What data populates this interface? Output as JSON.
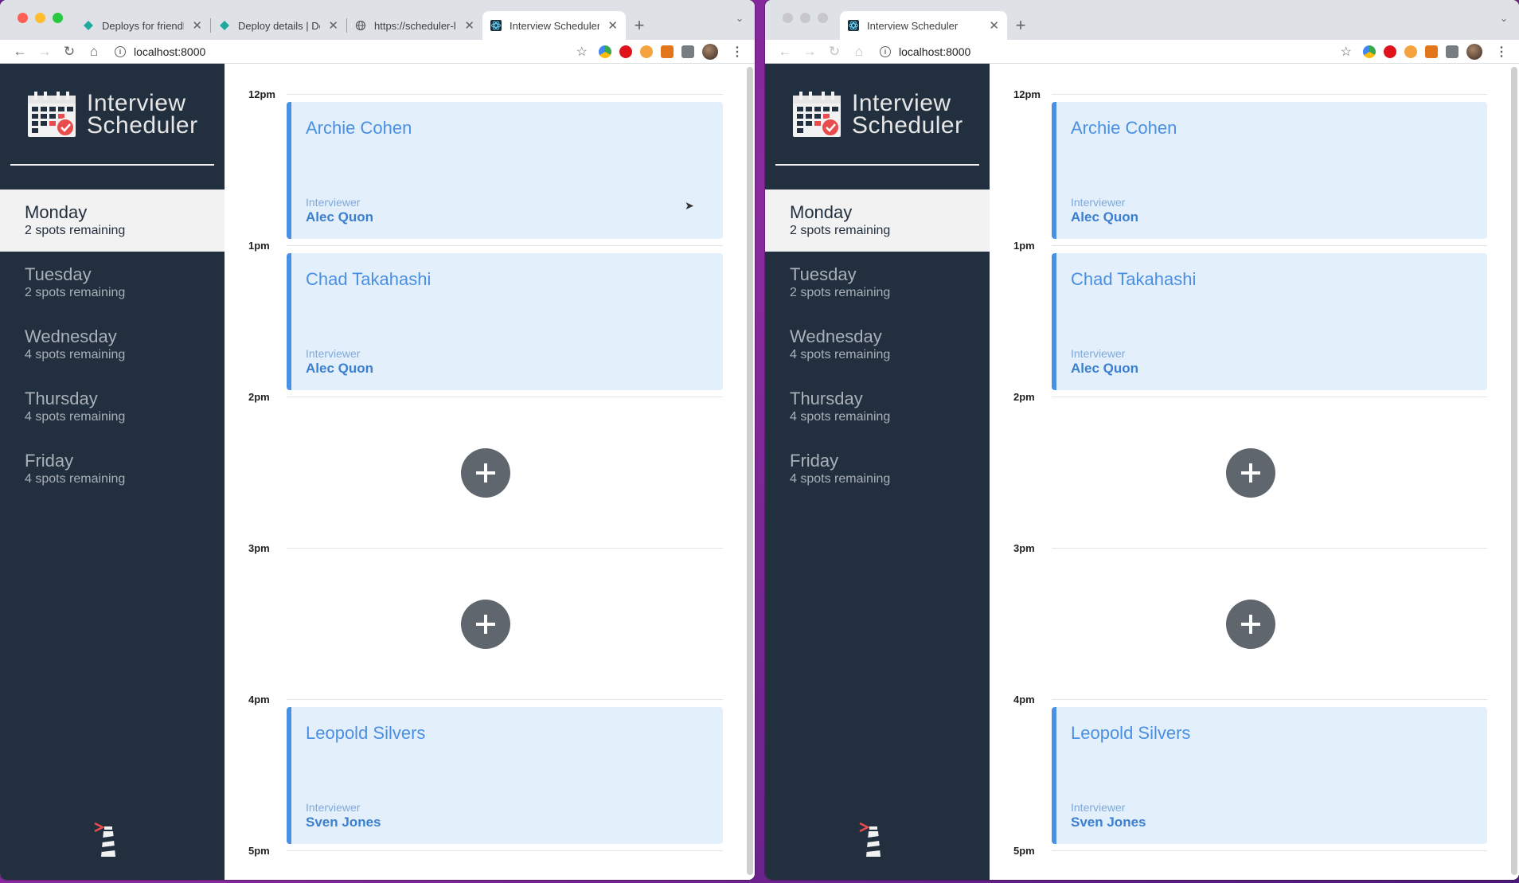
{
  "colors": {
    "sidebar": "#222f3e",
    "appointment_bg": "#e4effc",
    "accent": "#4a90e2",
    "add_button": "#5f666e"
  },
  "left_window": {
    "tabs": [
      {
        "label": "Deploys for friendly-p",
        "icon": "netlify-icon"
      },
      {
        "label": "Deploy details | Deplo",
        "icon": "netlify-icon"
      },
      {
        "label": "https://scheduler-lhl-",
        "icon": "globe-icon"
      },
      {
        "label": "Interview Scheduler",
        "icon": "react-icon"
      }
    ],
    "url": "localhost:8000"
  },
  "right_window": {
    "tabs": [
      {
        "label": "Interview Scheduler",
        "icon": "react-icon"
      }
    ],
    "url": "localhost:8000"
  },
  "app": {
    "logo_line1": "Interview",
    "logo_line2": "Scheduler",
    "days": [
      {
        "name": "Monday",
        "spots": "2 spots remaining"
      },
      {
        "name": "Tuesday",
        "spots": "2 spots remaining"
      },
      {
        "name": "Wednesday",
        "spots": "4 spots remaining"
      },
      {
        "name": "Thursday",
        "spots": "4 spots remaining"
      },
      {
        "name": "Friday",
        "spots": "4 spots remaining"
      }
    ],
    "times": [
      "12pm",
      "1pm",
      "2pm",
      "3pm",
      "4pm",
      "5pm"
    ],
    "appointments": [
      {
        "student": "Archie Cohen",
        "interviewer_label": "Interviewer",
        "interviewer": "Alec Quon"
      },
      {
        "student": "Chad Takahashi",
        "interviewer_label": "Interviewer",
        "interviewer": "Alec Quon"
      },
      {
        "student": "Leopold Silvers",
        "interviewer_label": "Interviewer",
        "interviewer": "Sven Jones"
      }
    ]
  }
}
